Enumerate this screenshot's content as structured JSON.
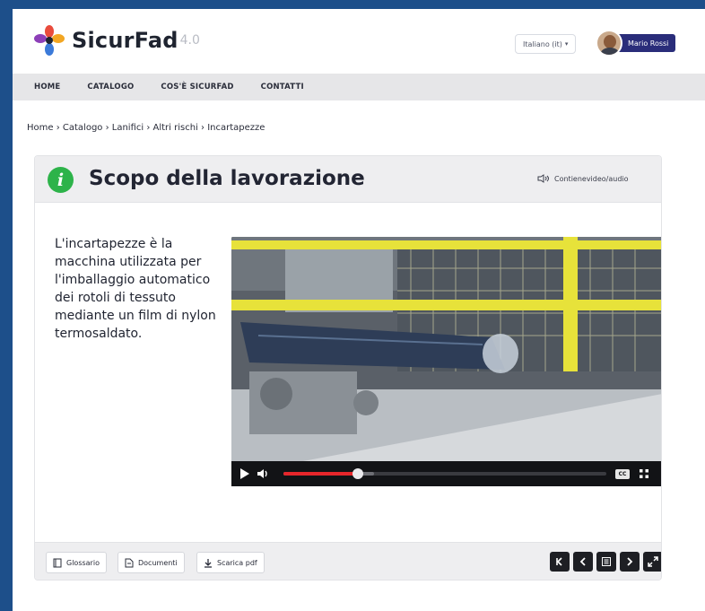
{
  "header": {
    "app_name": "SicurFad",
    "app_version": "4.0",
    "language": "Italiano (it)",
    "user_name": "Mario Rossi"
  },
  "nav": {
    "items": [
      "HOME",
      "CATALOGO",
      "COS'È SICURFAD",
      "CONTATTI"
    ]
  },
  "breadcrumb": "Home › Catalogo › Lanifici › Altri rischi › Incartapezze",
  "panel": {
    "title": "Scopo della lavorazione",
    "media_note": "Contienevideo/audio",
    "body": "L'incartapezze è la macchina utilizzata per l'imballaggio automatico dei rotoli di tessuto mediante un film di nylon termosaldato."
  },
  "video": {
    "progress": 0.23,
    "buffered": 0.28,
    "cc_label": "CC"
  },
  "footer": {
    "glossary_label": "Glossario",
    "documents_label": "Documenti",
    "download_label": "Scarica pdf"
  },
  "colors": {
    "brand_navy": "#2a2d7a",
    "info_green": "#2db34a",
    "progress_red": "#e6262b",
    "page_background": "#1d4f8a"
  }
}
